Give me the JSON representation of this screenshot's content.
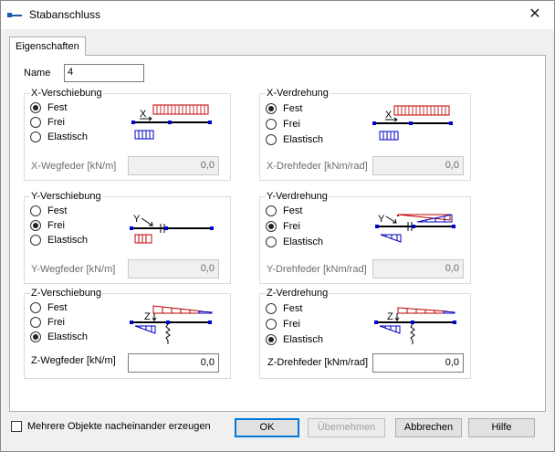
{
  "window": {
    "title": "Stabanschluss",
    "close_glyph": "✕"
  },
  "tabs": [
    {
      "label": "Eigenschaften"
    }
  ],
  "name": {
    "label": "Name",
    "value": "4"
  },
  "groups": {
    "x_shift": {
      "title": "X-Verschiebung",
      "options": [
        "Fest",
        "Frei",
        "Elastisch"
      ],
      "selected": "Fest",
      "spring_label": "X-Wegfeder [kN/m]",
      "spring_value": "0,0",
      "axis_glyph": "X"
    },
    "x_rot": {
      "title": "X-Verdrehung",
      "options": [
        "Fest",
        "Frei",
        "Elastisch"
      ],
      "selected": "Fest",
      "spring_label": "X-Drehfeder [kNm/rad]",
      "spring_value": "0,0",
      "axis_glyph": "X"
    },
    "y_shift": {
      "title": "Y-Verschiebung",
      "options": [
        "Fest",
        "Frei",
        "Elastisch"
      ],
      "selected": "Frei",
      "spring_label": "Y-Wegfeder [kN/m]",
      "spring_value": "0,0",
      "axis_glyph": "Y"
    },
    "y_rot": {
      "title": "Y-Verdrehung",
      "options": [
        "Fest",
        "Frei",
        "Elastisch"
      ],
      "selected": "Frei",
      "spring_label": "Y-Drehfeder [kNm/rad]",
      "spring_value": "0,0",
      "axis_glyph": "Y"
    },
    "z_shift": {
      "title": "Z-Verschiebung",
      "options": [
        "Fest",
        "Frei",
        "Elastisch"
      ],
      "selected": "Elastisch",
      "spring_label": "Z-Wegfeder [kN/m]",
      "spring_value": "0,0",
      "axis_glyph": "Z"
    },
    "z_rot": {
      "title": "Z-Verdrehung",
      "options": [
        "Fest",
        "Frei",
        "Elastisch"
      ],
      "selected": "Elastisch",
      "spring_label": "Z-Drehfeder [kNm/rad]",
      "spring_value": "0,0",
      "axis_glyph": "Z"
    }
  },
  "footer": {
    "checkbox_label": "Mehrere Objekte nacheinander erzeugen",
    "checkbox_checked": false,
    "ok": "OK",
    "apply": "Übernehmen",
    "cancel": "Abbrechen",
    "help": "Hilfe"
  }
}
